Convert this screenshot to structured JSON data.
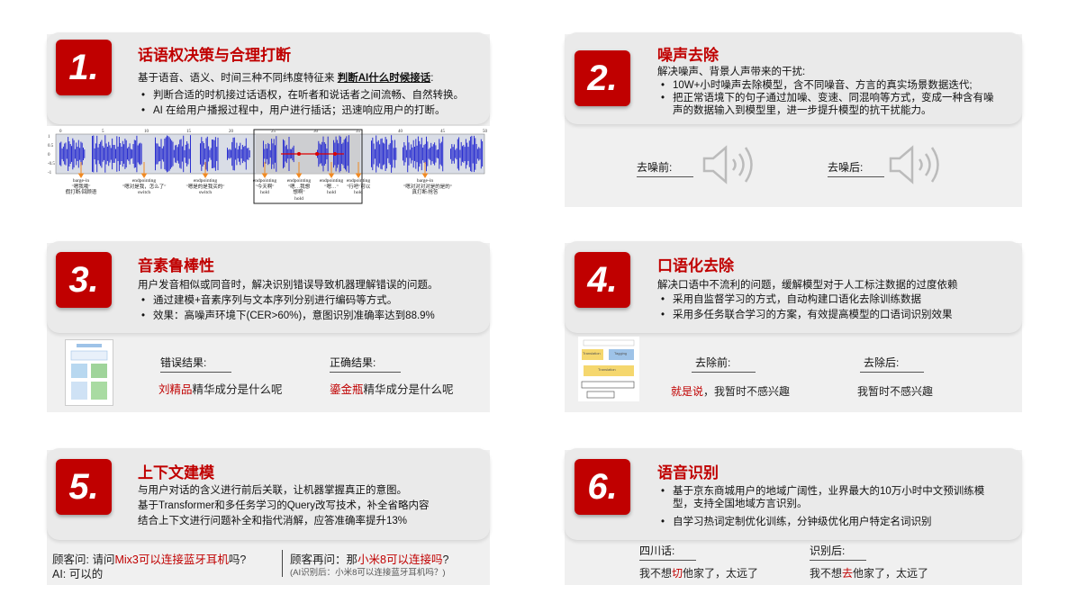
{
  "sections": [
    {
      "num": "1.",
      "title": "话语权决策与合理打断",
      "intro_prefix": "基于语音、语义、时间三种不同纬度特征来 ",
      "intro_bold": "判断AI什么时候接话",
      "intro_suffix": ":",
      "bullets": [
        "判断合适的时机接过话语权，在听者和说话者之间流畅、自然转换。",
        "AI 在给用户播报过程中，用户进行插话；迅速响应用户的打断。"
      ],
      "wave_ticks": [
        "0",
        "5",
        "10",
        "15",
        "20",
        "25",
        "30",
        "35",
        "40",
        "45",
        "50"
      ],
      "wave_ylabels": [
        "1",
        "0.5",
        "0",
        "-0.5",
        "-1"
      ],
      "wave_labels": [
        [
          "barge-in",
          "\"嗯我哦\"",
          "假打断/回顾语"
        ],
        [
          "endpointing",
          "\"嗯对是我，怎么了\"",
          "switch"
        ],
        [
          "endpointing",
          "\"嗯是的是我买的\"",
          "switch"
        ],
        [
          "endpointing",
          "\"今天啊\"",
          "hold"
        ],
        [
          "endpointing",
          "\"嗯…我想",
          "想啊\"",
          "hold"
        ],
        [
          "endpointing",
          "\"嗯…\"",
          "hold"
        ],
        [
          "endpointing",
          "\"行吧\"可以",
          "hold"
        ],
        [
          "barge-in",
          "\"嗯对对对对是的是的\"",
          "真打断/抢答"
        ]
      ]
    },
    {
      "num": "2.",
      "title": "噪声去除",
      "intro": "解决噪声、背景人声带来的干扰:",
      "bullets": [
        "10W+小时噪声去除模型，含不同噪音、方言的真实场景数据迭代;",
        "把正常语境下的句子通过加噪、变速、同混响等方式，变成一种含有噪声的数据输入到模型里，进一步提升模型的抗干扰能力。"
      ],
      "before_label": "去噪前:",
      "after_label": "去噪后:"
    },
    {
      "num": "3.",
      "title": "音素鲁棒性",
      "intro": "用户发音相似或同音时，解决识别错误导致机器理解错误的问题。",
      "bullets": [
        "通过建模+音素序列与文本序列分别进行编码等方式。",
        "效果：高噪声环境下(CER>60%)，意图识别准确率达到88.9%"
      ],
      "wrong_label": "错误结果:",
      "wrong_red": "刘精品",
      "wrong_rest": "精华成分是什么呢",
      "right_label": "正确结果:",
      "right_red": "鎏金瓶",
      "right_rest": "精华成分是什么呢"
    },
    {
      "num": "4.",
      "title": "口语化去除",
      "intro": "解决口语中不流利的问题，缓解模型对于人工标注数据的过度依赖",
      "bullets": [
        "采用自监督学习的方式，自动构建口语化去除训练数据",
        "采用多任务联合学习的方案，有效提高模型的口语词识别效果"
      ],
      "before_label": "去除前:",
      "before_red": "就是说",
      "before_rest": "，我暂时不感兴趣",
      "after_label": "去除后:",
      "after_text": "我暂时不感兴趣",
      "diagram_labels": [
        "Translation",
        "Tagging",
        "Translation"
      ]
    },
    {
      "num": "5.",
      "title": "上下文建模",
      "lines": [
        "与用户对话的含义进行前后关联，让机器掌握真正的意图。",
        "基于Transformer和多任务学习的Query改写技术，补全省略内容",
        "结合上下文进行问题补全和指代消解，应答准确率提升13%"
      ],
      "q1_prefix": "顾客问: 请问",
      "q1_red": "Mix3可以连接蓝牙耳机",
      "q1_suffix": "吗?",
      "a1": "AI: 可以的",
      "q2_prefix": "顾客再问：那",
      "q2_red": "小米8可以连接吗",
      "q2_suffix": "?",
      "q2_note": "(AI识别后：小米8可以连接蓝牙耳机吗？)"
    },
    {
      "num": "6.",
      "title": "语音识别",
      "bullets": [
        "基于京东商城用户的地域广阔性，业界最大的10万小时中文预训练模型，支持全国地域方言识别。",
        "自学习热词定制优化训练，分钟级优化用户特定名词识别"
      ],
      "left_label": "四川话:",
      "left_pre": "我不想",
      "left_red": "切",
      "left_post": "他家了，太远了",
      "right_label": "识别后:",
      "right_pre": "我不想",
      "right_red": "去",
      "right_post": "他家了，太远了"
    }
  ]
}
